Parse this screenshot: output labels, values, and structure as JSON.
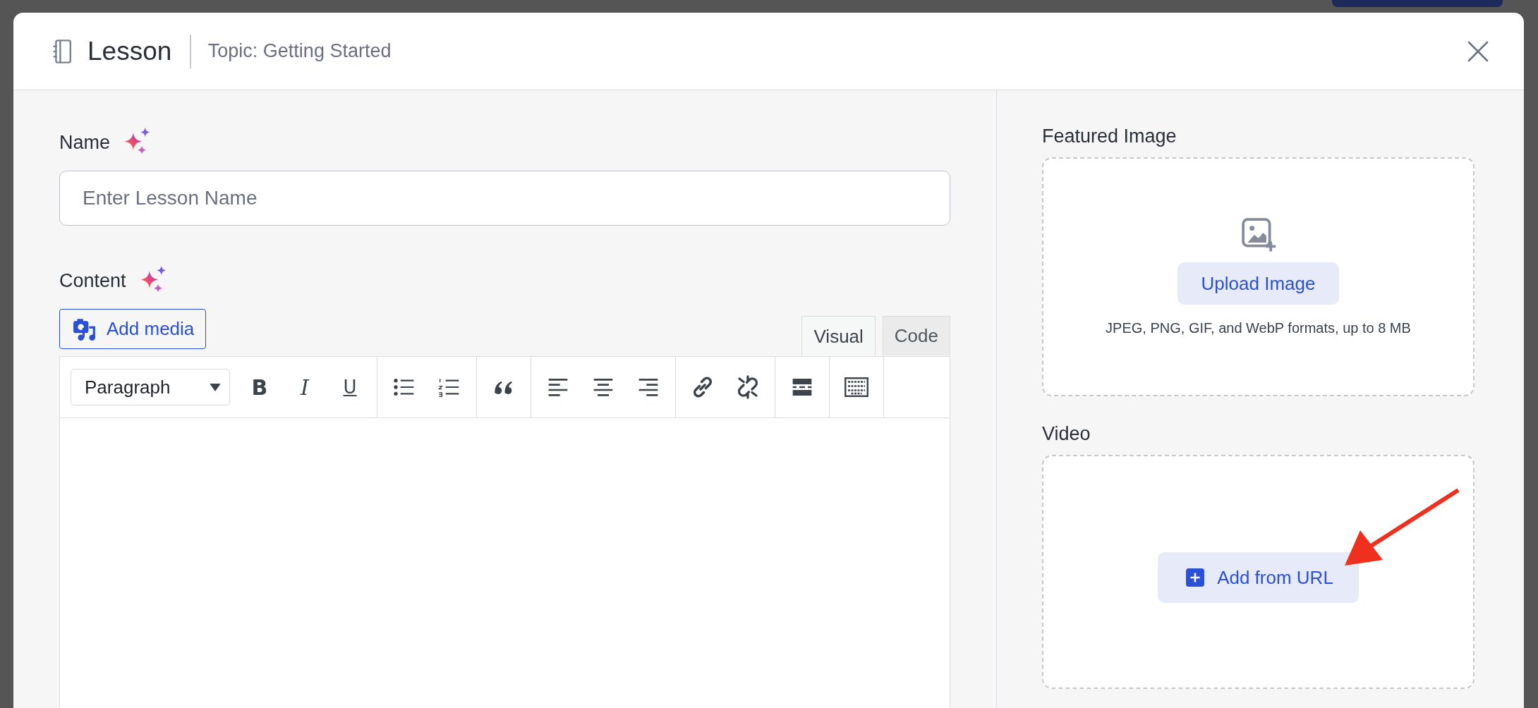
{
  "header": {
    "title": "Lesson",
    "subtitle": "Topic: Getting Started"
  },
  "name_field": {
    "label": "Name",
    "placeholder": "Enter Lesson Name"
  },
  "content": {
    "label": "Content",
    "add_media": "Add media",
    "tabs": [
      {
        "label": "Visual",
        "selected": true
      },
      {
        "label": "Code",
        "selected": false
      }
    ],
    "format_select": "Paragraph",
    "toolbar": [
      [
        {
          "kind": "bold",
          "glyph": "B"
        },
        {
          "kind": "italic",
          "glyph": "I"
        },
        {
          "kind": "underline",
          "glyph": "U"
        }
      ],
      [
        {
          "kind": "bullet-list"
        },
        {
          "kind": "numbered-list"
        }
      ],
      [
        {
          "kind": "quote"
        }
      ],
      [
        {
          "kind": "align-left"
        },
        {
          "kind": "align-center"
        },
        {
          "kind": "align-right"
        }
      ],
      [
        {
          "kind": "link"
        },
        {
          "kind": "unlink"
        }
      ],
      [
        {
          "kind": "read-more"
        }
      ],
      [
        {
          "kind": "toolbar-toggle"
        }
      ]
    ]
  },
  "featured_image": {
    "label": "Featured Image",
    "button": "Upload Image",
    "hint": "JPEG, PNG, GIF, and WebP formats, up to 8 MB"
  },
  "video": {
    "label": "Video",
    "button": "Add from URL"
  }
}
